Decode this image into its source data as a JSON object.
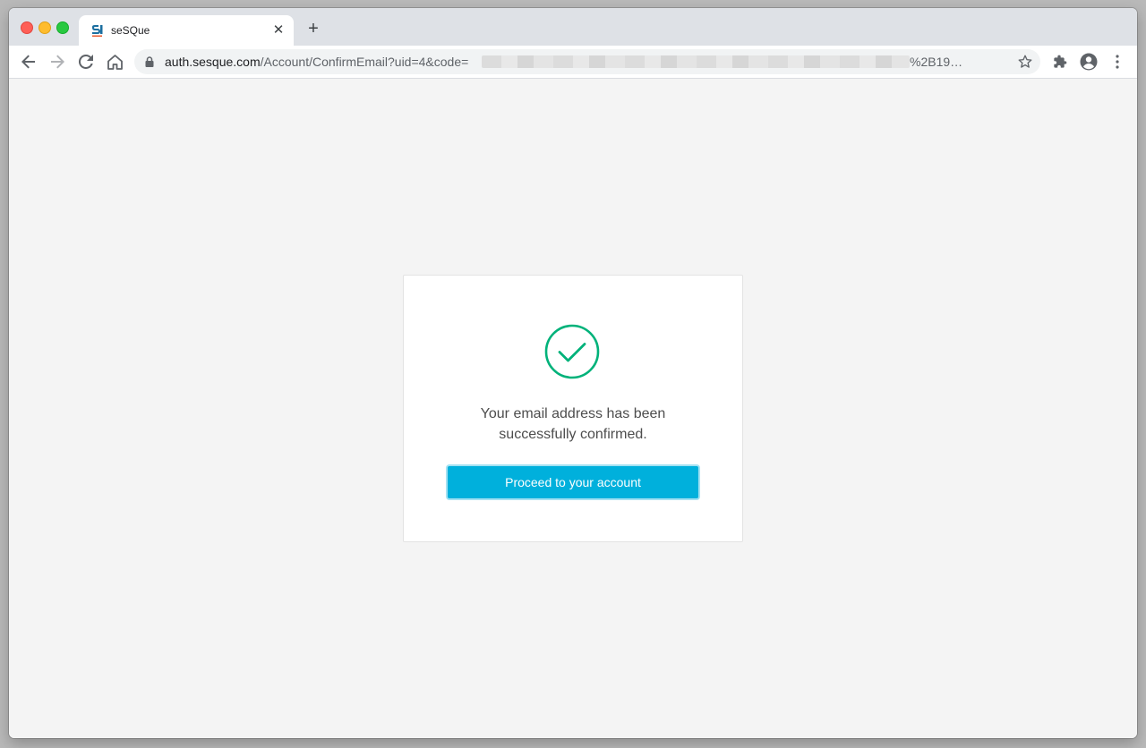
{
  "browser": {
    "tab": {
      "title": "seSQue"
    },
    "address_bar": {
      "host": "auth.sesque.com",
      "path_visible": "/Account/ConfirmEmail?uid=4&code=",
      "path_tail": "%2B19…"
    }
  },
  "page": {
    "message_line1": "Your email address has been",
    "message_line2": "successfully confirmed.",
    "proceed_button_label": "Proceed to your account"
  },
  "colors": {
    "accent": "#00b0dc",
    "success": "#00b27a"
  },
  "icons": [
    "back-icon",
    "forward-icon",
    "reload-icon",
    "home-icon",
    "lock-icon",
    "star-icon",
    "extensions-icon",
    "profile-icon",
    "menu-icon",
    "check-circle-icon"
  ]
}
